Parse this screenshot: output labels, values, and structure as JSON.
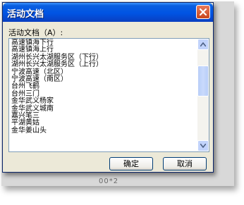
{
  "dialog": {
    "title": "活动文档",
    "close_glyph": "✕",
    "list_label": "活动文档（A）:",
    "items": [
      "高速镇海下行",
      "高速镇海上行",
      "湖州长兴太湖服务区（下行）",
      "湖州长兴太湖服务区（上行）",
      "宁波高速（北区）",
      "宁波高速（南区）",
      "台州飞鹤",
      "台州三门",
      "金华武义杨家",
      "金华武义城南",
      "嘉兴笔三",
      "平湖黄姑",
      "金华姜山头"
    ],
    "ok_label": "确定",
    "cancel_label": "取消"
  },
  "background": {
    "partial_text": "00*2"
  },
  "colors": {
    "titlebar": "#0054e3",
    "dialog_bg": "#ece9d8",
    "close_button": "#c8461c",
    "scrollbar": "#c1d3fb"
  }
}
